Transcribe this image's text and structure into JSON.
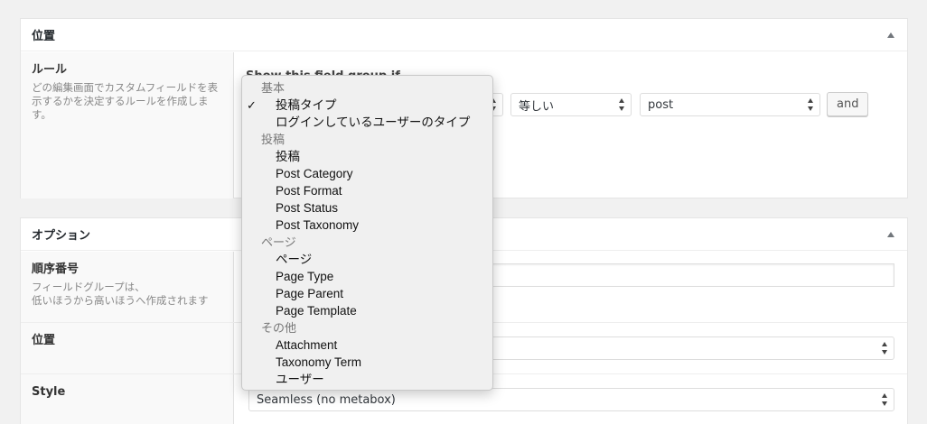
{
  "location_box": {
    "title": "位置",
    "rules_label": "ルール",
    "rules_desc": "どの編集画面でカスタムフィールドを表示するかを決定するルールを作成します。",
    "show_if_text": "Show this field group if",
    "operator_value": "等しい",
    "value_value": "post",
    "and_label": "and"
  },
  "options_box": {
    "title": "オプション",
    "order_label": "順序番号",
    "order_desc_1": "フィールドグループは、",
    "order_desc_2": "低いほうから高いほうへ作成されます",
    "position_label": "位置",
    "style_label": "Style",
    "style_value": "Seamless (no metabox)"
  },
  "dropdown": {
    "selected": "投稿タイプ",
    "groups": [
      {
        "label": "基本",
        "items": [
          "投稿タイプ",
          "ログインしているユーザーのタイプ"
        ]
      },
      {
        "label": "投稿",
        "items": [
          "投稿",
          "Post Category",
          "Post Format",
          "Post Status",
          "Post Taxonomy"
        ]
      },
      {
        "label": "ページ",
        "items": [
          "ページ",
          "Page Type",
          "Page Parent",
          "Page Template"
        ]
      },
      {
        "label": "その他",
        "items": [
          "Attachment",
          "Taxonomy Term",
          "ユーザー"
        ]
      }
    ]
  }
}
